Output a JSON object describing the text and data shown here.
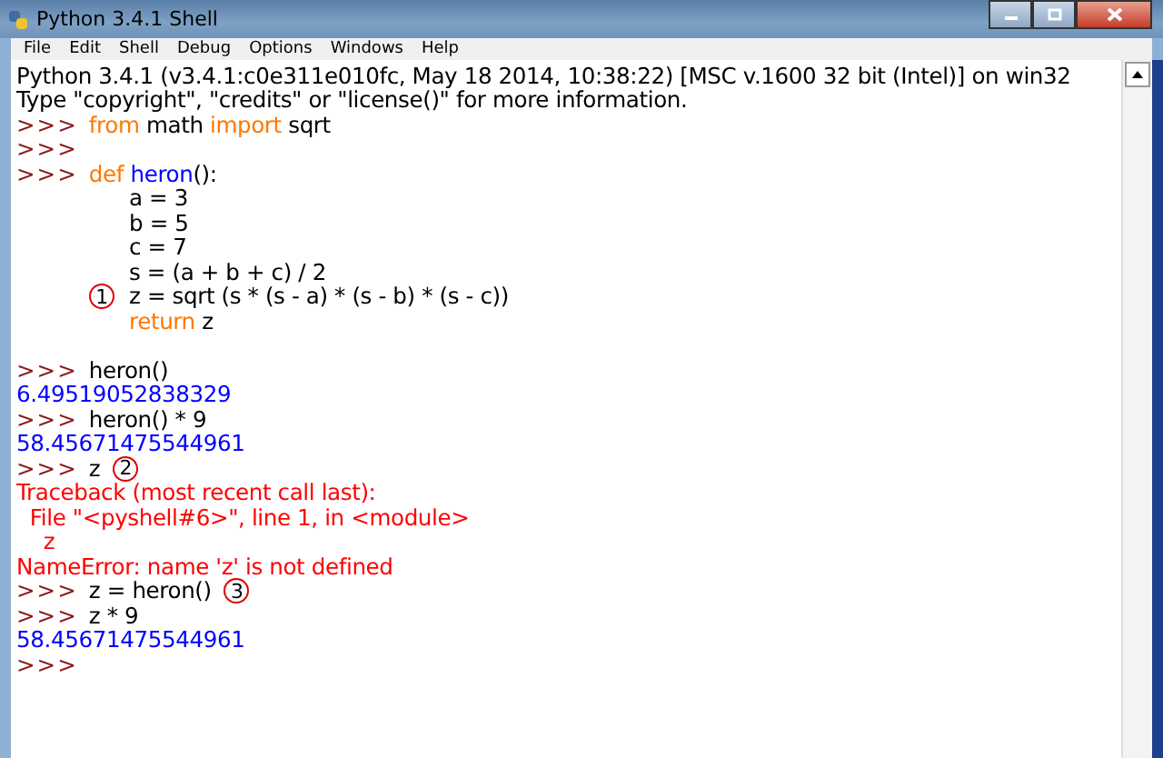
{
  "window": {
    "title": "Python 3.4.1 Shell"
  },
  "menu": [
    "File",
    "Edit",
    "Shell",
    "Debug",
    "Options",
    "Windows",
    "Help"
  ],
  "lines": [
    {
      "kind": "output",
      "segments": [
        {
          "text": "Python 3.4.1 (v3.4.1:c0e311e010fc, May 18 2014, 10:38:22) [MSC v.1600 32 bit (Intel)] on win32",
          "kind": "plain"
        }
      ]
    },
    {
      "kind": "output",
      "segments": [
        {
          "text": "Type \"copyright\", \"credits\" or \"license()\" for more information.",
          "kind": "plain"
        }
      ]
    },
    {
      "kind": "input",
      "prompt": ">>>",
      "segments": [
        {
          "text": "from",
          "kind": "keyword"
        },
        {
          "text": " math ",
          "kind": "plain"
        },
        {
          "text": "import",
          "kind": "keyword"
        },
        {
          "text": " sqrt",
          "kind": "plain"
        }
      ]
    },
    {
      "kind": "input",
      "prompt": ">>>"
    },
    {
      "kind": "input",
      "prompt": ">>>",
      "segments": [
        {
          "text": "def",
          "kind": "keyword"
        },
        {
          "text": " heron",
          "kind": "function_name"
        },
        {
          "text": "():",
          "kind": "plain"
        }
      ]
    },
    {
      "kind": "continuation",
      "segments": [
        {
          "text": "a = 3",
          "kind": "plain"
        }
      ]
    },
    {
      "kind": "continuation",
      "segments": [
        {
          "text": "b = 5",
          "kind": "plain"
        }
      ]
    },
    {
      "kind": "continuation",
      "segments": [
        {
          "text": "c = 7",
          "kind": "plain"
        }
      ]
    },
    {
      "kind": "continuation",
      "segments": [
        {
          "text": "s = (a + b + c) / 2",
          "kind": "plain"
        }
      ]
    },
    {
      "kind": "continuation",
      "marker": "1",
      "segments": [
        {
          "text": "z = sqrt (s * (s - a) * (s - b) * (s - c))",
          "kind": "plain"
        }
      ]
    },
    {
      "kind": "continuation",
      "segments": [
        {
          "text": "return",
          "kind": "keyword"
        },
        {
          "text": " z",
          "kind": "plain"
        }
      ]
    },
    {
      "kind": "blank"
    },
    {
      "kind": "input",
      "prompt": ">>>",
      "segments": [
        {
          "text": "heron()",
          "kind": "plain"
        }
      ]
    },
    {
      "kind": "output",
      "segments": [
        {
          "text": "6.49519052838329",
          "kind": "result"
        }
      ]
    },
    {
      "kind": "input",
      "prompt": ">>>",
      "segments": [
        {
          "text": "heron() * 9",
          "kind": "plain"
        }
      ]
    },
    {
      "kind": "output",
      "segments": [
        {
          "text": "58.45671475544961",
          "kind": "result"
        }
      ]
    },
    {
      "kind": "input",
      "prompt": ">>>",
      "marker": "2",
      "segments": [
        {
          "text": "z",
          "kind": "plain"
        }
      ]
    },
    {
      "kind": "output",
      "segments": [
        {
          "text": "Traceback (most recent call last):",
          "kind": "error"
        }
      ]
    },
    {
      "kind": "output",
      "segments": [
        {
          "text": "  File \"<pyshell#6>\", line 1, in <module>",
          "kind": "error"
        }
      ]
    },
    {
      "kind": "output",
      "segments": [
        {
          "text": "    z",
          "kind": "error"
        }
      ]
    },
    {
      "kind": "output",
      "segments": [
        {
          "text": "NameError: name 'z' is not defined",
          "kind": "error"
        }
      ]
    },
    {
      "kind": "input",
      "prompt": ">>>",
      "marker": "3",
      "segments": [
        {
          "text": "z = heron()",
          "kind": "plain"
        }
      ]
    },
    {
      "kind": "input",
      "prompt": ">>>",
      "segments": [
        {
          "text": "z * 9",
          "kind": "plain"
        }
      ]
    },
    {
      "kind": "output",
      "segments": [
        {
          "text": "58.45671475544961",
          "kind": "result"
        }
      ]
    },
    {
      "kind": "input",
      "prompt": ">>>"
    }
  ]
}
